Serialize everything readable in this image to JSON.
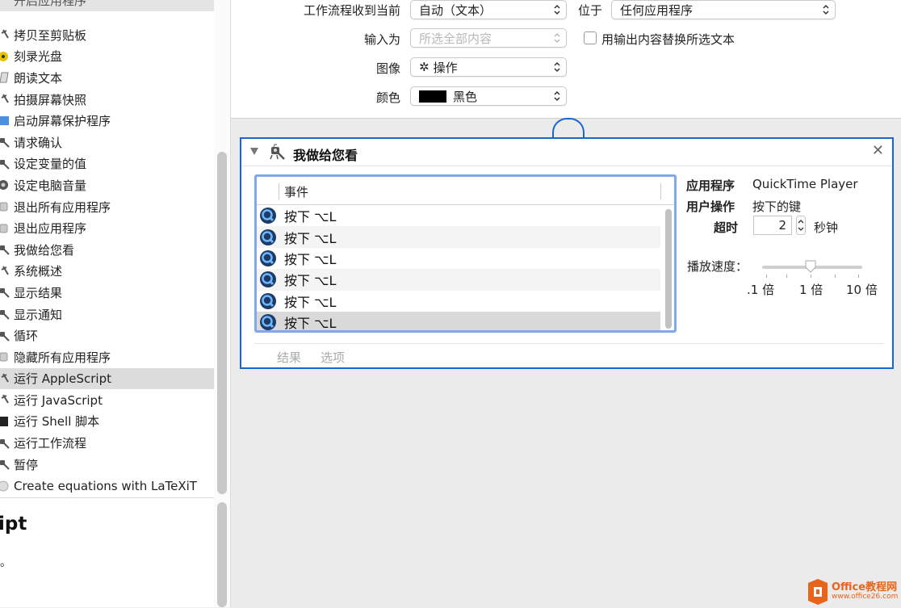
{
  "sidebar": {
    "cut_item": "开启应用程序",
    "items": [
      {
        "label": "拷贝至剪贴板",
        "icon": "wrench-icon"
      },
      {
        "label": "刻录光盘",
        "icon": "disc-icon"
      },
      {
        "label": "朗读文本",
        "icon": "script-icon"
      },
      {
        "label": "拍摄屏幕快照",
        "icon": "wrench-icon"
      },
      {
        "label": "启动屏幕保护程序",
        "icon": "screensaver-icon"
      },
      {
        "label": "请求确认",
        "icon": "robot-icon"
      },
      {
        "label": "设定变量的值",
        "icon": "robot-icon"
      },
      {
        "label": "设定电脑音量",
        "icon": "speaker-icon"
      },
      {
        "label": "退出所有应用程序",
        "icon": "app-icon"
      },
      {
        "label": "退出应用程序",
        "icon": "app-icon"
      },
      {
        "label": "我做给您看",
        "icon": "robot-icon"
      },
      {
        "label": "系统概述",
        "icon": "wrench-icon"
      },
      {
        "label": "显示结果",
        "icon": "robot-icon"
      },
      {
        "label": "显示通知",
        "icon": "robot-icon"
      },
      {
        "label": "循环",
        "icon": "robot-icon"
      },
      {
        "label": "隐藏所有应用程序",
        "icon": "app-icon"
      },
      {
        "label": "运行 AppleScript",
        "icon": "wrench-icon",
        "selected": true
      },
      {
        "label": "运行 JavaScript",
        "icon": "wrench-icon"
      },
      {
        "label": "运行 Shell 脚本",
        "icon": "terminal-icon"
      },
      {
        "label": "运行工作流程",
        "icon": "robot-icon"
      },
      {
        "label": "暂停",
        "icon": "robot-icon"
      },
      {
        "label": "Create equations with LaTeXiT",
        "icon": "latexit-icon"
      }
    ],
    "description_title": "ipt",
    "description_text": "。"
  },
  "form": {
    "receive_label": "工作流程收到当前",
    "receive_value": "自动（文本）",
    "in_label": "位于",
    "in_value": "任何应用程序",
    "input_label": "输入为",
    "input_value": "所选全部内容",
    "replace_label": "用输出内容替换所选文本",
    "image_label": "图像",
    "image_value": "操作",
    "color_label": "颜色",
    "color_value": "黑色",
    "color_swatch": "#000000"
  },
  "card": {
    "title": "我做给您看",
    "column_header": "事件",
    "events": [
      "按下 ⌥L",
      "按下 ⌥L",
      "按下 ⌥L",
      "按下 ⌥L",
      "按下 ⌥L",
      "按下 ⌥L"
    ],
    "app_label": "应用程序",
    "app_value": "QuickTime Player",
    "action_label": "用户操作",
    "action_value": "按下的键",
    "timeout_label": "超时",
    "timeout_value": "2",
    "timeout_unit": "秒钟",
    "speed_label": "播放速度：",
    "speed_ticks": [
      ".1 倍",
      "1 倍",
      "10 倍"
    ],
    "results_label": "结果",
    "options_label": "选项"
  },
  "watermark": {
    "name": "Office教程网",
    "url": "www.office26.com"
  },
  "colors": {
    "accent": "#1a66d0",
    "selected_row": "#dcdcdc"
  }
}
